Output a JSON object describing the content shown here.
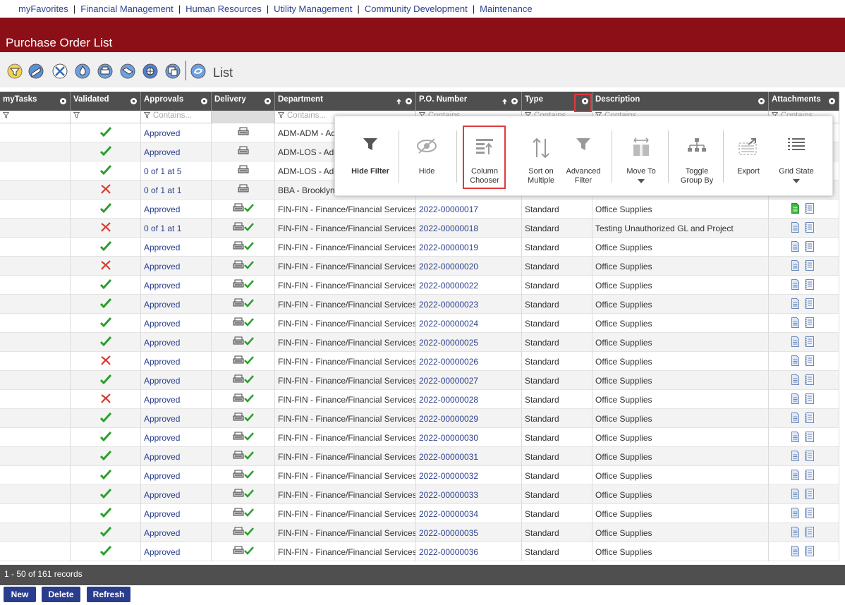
{
  "topnav": [
    "myFavorites",
    "Financial Management",
    "Human Resources",
    "Utility Management",
    "Community Development",
    "Maintenance"
  ],
  "page_title": "Purchase Order List",
  "toolbar": {
    "icons": [
      "filter-funnel-icon",
      "approve-icon",
      "tools-icon",
      "flame-icon",
      "print-icon",
      "copy-icon",
      "globe-icon",
      "window-icon",
      "cycle-icon"
    ],
    "label": "List"
  },
  "columns": [
    "myTasks",
    "Validated",
    "Approvals",
    "Delivery",
    "Department",
    "P.O. Number",
    "Type",
    "Description",
    "Attachments"
  ],
  "filter_placeholder": "Contains...",
  "grid_menu": {
    "items": [
      {
        "label": "Hide Filter",
        "icon": "funnel-icon"
      },
      {
        "label": "Hide",
        "icon": "hidden-eye-icon"
      },
      {
        "label": "Column Chooser",
        "icon": "column-chooser-icon"
      },
      {
        "label": "Sort on Multiple",
        "icon": "sort-arrows-icon"
      },
      {
        "label": "Advanced Filter",
        "icon": "advanced-filter-icon"
      },
      {
        "label": "Move To",
        "icon": "move-columns-icon"
      },
      {
        "label": "Toggle Group By",
        "icon": "group-tree-icon"
      },
      {
        "label": "Export",
        "icon": "export-icon"
      },
      {
        "label": "Grid State",
        "icon": "list-lines-icon"
      }
    ]
  },
  "rows": [
    {
      "validated": "check",
      "approval": "Approved",
      "delivery": "print",
      "department": "ADM-ADM - Ad",
      "po": "",
      "type": "",
      "description": "",
      "attach": "none"
    },
    {
      "validated": "check",
      "approval": "Approved",
      "delivery": "print",
      "department": "ADM-LOS - Ad",
      "po": "",
      "type": "",
      "description": "",
      "attach": "none"
    },
    {
      "validated": "check",
      "approval": "0 of 1 at 5",
      "delivery": "print",
      "department": "ADM-LOS - Ad",
      "po": "",
      "type": "",
      "description": "",
      "attach": "none"
    },
    {
      "validated": "cross",
      "approval": "0 of 1 at 1",
      "delivery": "print",
      "department": "BBA - Brooklyn",
      "po": "",
      "type": "",
      "description": "",
      "attach": "none"
    },
    {
      "validated": "check",
      "approval": "Approved",
      "delivery": "printcheck",
      "department": "FIN-FIN - Finance/Financial Services",
      "po": "2022-00000017",
      "type": "Standard",
      "description": "Office Supplies",
      "attach": "green"
    },
    {
      "validated": "cross",
      "approval": "0 of 1 at 1",
      "delivery": "printcheck",
      "department": "FIN-FIN - Finance/Financial Services",
      "po": "2022-00000018",
      "type": "Standard",
      "description": "Testing Unauthorized GL and Project",
      "attach": "blue"
    },
    {
      "validated": "check",
      "approval": "Approved",
      "delivery": "printcheck",
      "department": "FIN-FIN - Finance/Financial Services",
      "po": "2022-00000019",
      "type": "Standard",
      "description": "Office Supplies",
      "attach": "blue"
    },
    {
      "validated": "cross",
      "approval": "Approved",
      "delivery": "printcheck",
      "department": "FIN-FIN - Finance/Financial Services",
      "po": "2022-00000020",
      "type": "Standard",
      "description": "Office Supplies",
      "attach": "blue"
    },
    {
      "validated": "check",
      "approval": "Approved",
      "delivery": "printcheck",
      "department": "FIN-FIN - Finance/Financial Services",
      "po": "2022-00000022",
      "type": "Standard",
      "description": "Office Supplies",
      "attach": "blue"
    },
    {
      "validated": "check",
      "approval": "Approved",
      "delivery": "printcheck",
      "department": "FIN-FIN - Finance/Financial Services",
      "po": "2022-00000023",
      "type": "Standard",
      "description": "Office Supplies",
      "attach": "blue"
    },
    {
      "validated": "check",
      "approval": "Approved",
      "delivery": "printcheck",
      "department": "FIN-FIN - Finance/Financial Services",
      "po": "2022-00000024",
      "type": "Standard",
      "description": "Office Supplies",
      "attach": "blue"
    },
    {
      "validated": "check",
      "approval": "Approved",
      "delivery": "printcheck",
      "department": "FIN-FIN - Finance/Financial Services",
      "po": "2022-00000025",
      "type": "Standard",
      "description": "Office Supplies",
      "attach": "blue"
    },
    {
      "validated": "cross",
      "approval": "Approved",
      "delivery": "printcheck",
      "department": "FIN-FIN - Finance/Financial Services",
      "po": "2022-00000026",
      "type": "Standard",
      "description": "Office Supplies",
      "attach": "blue"
    },
    {
      "validated": "check",
      "approval": "Approved",
      "delivery": "printcheck",
      "department": "FIN-FIN - Finance/Financial Services",
      "po": "2022-00000027",
      "type": "Standard",
      "description": "Office Supplies",
      "attach": "blue"
    },
    {
      "validated": "cross",
      "approval": "Approved",
      "delivery": "printcheck",
      "department": "FIN-FIN - Finance/Financial Services",
      "po": "2022-00000028",
      "type": "Standard",
      "description": "Office Supplies",
      "attach": "blue"
    },
    {
      "validated": "check",
      "approval": "Approved",
      "delivery": "printcheck",
      "department": "FIN-FIN - Finance/Financial Services",
      "po": "2022-00000029",
      "type": "Standard",
      "description": "Office Supplies",
      "attach": "blue"
    },
    {
      "validated": "check",
      "approval": "Approved",
      "delivery": "printcheck",
      "department": "FIN-FIN - Finance/Financial Services",
      "po": "2022-00000030",
      "type": "Standard",
      "description": "Office Supplies",
      "attach": "blue"
    },
    {
      "validated": "check",
      "approval": "Approved",
      "delivery": "printcheck",
      "department": "FIN-FIN - Finance/Financial Services",
      "po": "2022-00000031",
      "type": "Standard",
      "description": "Office Supplies",
      "attach": "blue"
    },
    {
      "validated": "check",
      "approval": "Approved",
      "delivery": "printcheck",
      "department": "FIN-FIN - Finance/Financial Services",
      "po": "2022-00000032",
      "type": "Standard",
      "description": "Office Supplies",
      "attach": "blue"
    },
    {
      "validated": "check",
      "approval": "Approved",
      "delivery": "printcheck",
      "department": "FIN-FIN - Finance/Financial Services",
      "po": "2022-00000033",
      "type": "Standard",
      "description": "Office Supplies",
      "attach": "blue"
    },
    {
      "validated": "check",
      "approval": "Approved",
      "delivery": "printcheck",
      "department": "FIN-FIN - Finance/Financial Services",
      "po": "2022-00000034",
      "type": "Standard",
      "description": "Office Supplies",
      "attach": "blue"
    },
    {
      "validated": "check",
      "approval": "Approved",
      "delivery": "printcheck",
      "department": "FIN-FIN - Finance/Financial Services",
      "po": "2022-00000035",
      "type": "Standard",
      "description": "Office Supplies",
      "attach": "blue"
    },
    {
      "validated": "check",
      "approval": "Approved",
      "delivery": "printcheck",
      "department": "FIN-FIN - Finance/Financial Services",
      "po": "2022-00000036",
      "type": "Standard",
      "description": "Office Supplies",
      "attach": "blue"
    }
  ],
  "footer": {
    "records": "1 - 50 of 161 records"
  },
  "buttons": {
    "new": "New",
    "delete": "Delete",
    "refresh": "Refresh"
  },
  "colors": {
    "brand": "#8c0f18",
    "header": "#4f4f4f",
    "link": "#2b3f8f",
    "check": "#2aa02a",
    "cross": "#d63b2f",
    "highlight": "#e0393e"
  }
}
